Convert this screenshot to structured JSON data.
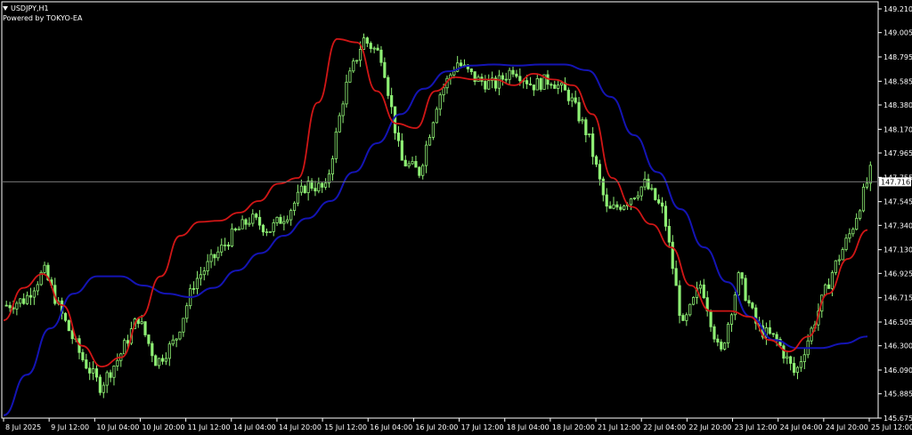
{
  "header": {
    "symbol": "USDJPY,H1",
    "credit": "Powered by TOKYO-EA"
  },
  "current_price": "147.716",
  "colors": {
    "background": "#000000",
    "candle": "#8ef074",
    "ma_fast": "#d01616",
    "ma_slow": "#1414b4",
    "axis": "#ffffff",
    "price_line": "#777777"
  },
  "chart_data": {
    "type": "line",
    "title": "USDJPY,H1",
    "series": [
      {
        "name": "",
        "values": [
          146.65,
          146.7,
          146.95,
          146.55,
          146.2,
          145.95,
          146.2,
          146.55,
          146.15,
          146.35,
          146.85,
          147.05,
          147.25,
          147.4,
          147.3,
          147.45,
          147.7,
          147.65,
          148.5,
          148.95,
          148.8,
          147.9,
          147.8,
          148.45,
          148.75,
          148.6,
          148.55,
          148.7,
          148.55,
          148.6,
          148.45,
          148.1,
          147.45,
          147.55,
          147.7,
          147.45,
          146.45,
          146.85,
          146.2,
          146.9,
          146.45,
          146.35,
          146.05,
          146.5,
          146.95,
          147.3,
          147.8
        ]
      },
      {
        "name": "",
        "values": [
          146.52,
          146.8,
          146.92,
          146.65,
          146.3,
          146.12,
          146.2,
          146.55,
          146.9,
          147.25,
          147.37,
          147.38,
          147.45,
          147.55,
          147.7,
          147.75,
          148.4,
          148.95,
          148.92,
          148.5,
          148.22,
          148.18,
          148.5,
          148.62,
          148.6,
          148.6,
          148.55,
          148.65,
          148.6,
          148.55,
          148.3,
          147.75,
          147.5,
          147.35,
          147.15,
          146.82,
          146.6,
          146.6,
          146.55,
          146.35,
          146.25,
          146.38,
          146.75,
          147.05,
          147.3
        ]
      },
      {
        "name": "",
        "values": [
          145.7,
          146.05,
          146.45,
          146.75,
          146.9,
          146.9,
          146.82,
          146.75,
          146.72,
          146.8,
          146.95,
          147.1,
          147.25,
          147.4,
          147.55,
          147.8,
          148.05,
          148.3,
          148.52,
          148.67,
          148.72,
          148.73,
          148.72,
          148.73,
          148.73,
          148.68,
          148.45,
          148.12,
          147.8,
          147.48,
          147.15,
          146.85,
          146.55,
          146.35,
          146.28,
          146.28,
          146.32,
          146.38
        ]
      }
    ],
    "x_ticks": [
      "8 Jul 2025",
      "9 Jul 12:00",
      "10 Jul 04:00",
      "10 Jul 20:00",
      "11 Jul 12:00",
      "14 Jul 04:00",
      "14 Jul 20:00",
      "15 Jul 12:00",
      "16 Jul 04:00",
      "16 Jul 20:00",
      "17 Jul 12:00",
      "18 Jul 04:00",
      "18 Jul 20:00",
      "21 Jul 12:00",
      "22 Jul 04:00",
      "22 Jul 20:00",
      "23 Jul 12:00",
      "24 Jul 04:00",
      "24 Jul 20:00",
      "25 Jul 12:00"
    ],
    "y_ticks": [
      "149.210",
      "149.005",
      "148.795",
      "148.585",
      "148.380",
      "148.170",
      "147.965",
      "147.755",
      "147.545",
      "147.340",
      "147.130",
      "146.925",
      "146.715",
      "146.505",
      "146.300",
      "146.090",
      "145.885",
      "145.675"
    ],
    "ylim": [
      145.675,
      149.21
    ],
    "grid": false,
    "legend": "none"
  }
}
